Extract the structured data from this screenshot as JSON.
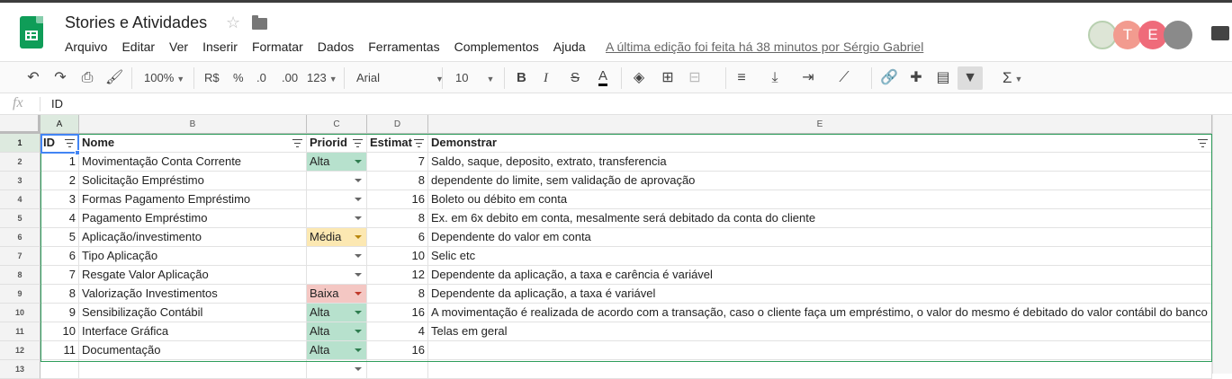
{
  "app": {
    "title": "Stories e Atividades",
    "last_edit": "A última edição foi feita há 38 minutos por Sérgio Gabriel",
    "menu": [
      "Arquivo",
      "Editar",
      "Ver",
      "Inserir",
      "Formatar",
      "Dados",
      "Ferramentas",
      "Complementos",
      "Ajuda"
    ],
    "avatars": [
      "",
      "T",
      "E",
      ""
    ],
    "accent_color": "#0f9d58"
  },
  "toolbar": {
    "zoom": "100%",
    "currency": "R$",
    "percent": "%",
    "dec_decrease": ".0",
    "dec_increase": ".00",
    "format_more": "123",
    "font": "Arial",
    "font_size": "10",
    "bold": "B",
    "italic": "I",
    "strike": "S",
    "text_color": "A",
    "sigma": "Σ"
  },
  "formula_bar": {
    "fx": "fx",
    "value": "ID"
  },
  "sheet": {
    "column_letters": [
      "A",
      "B",
      "C",
      "D",
      "E"
    ],
    "headers": [
      "ID",
      "Nome",
      "Priorid",
      "Estimat",
      "Demonstrar"
    ],
    "row_numbers": [
      "1",
      "2",
      "3",
      "4",
      "5",
      "6",
      "7",
      "8",
      "9",
      "10",
      "11",
      "12",
      "13"
    ],
    "rows": [
      {
        "id": "1",
        "nome": "Movimentação Conta Corrente",
        "prioridade": "Alta",
        "estimativa": "7",
        "demonstrar": "Saldo, saque, deposito, extrato, transferencia"
      },
      {
        "id": "2",
        "nome": "Solicitação Empréstimo",
        "prioridade": "",
        "estimativa": "8",
        "demonstrar": "dependente do limite, sem validação de aprovação"
      },
      {
        "id": "3",
        "nome": "Formas Pagamento Empréstimo",
        "prioridade": "",
        "estimativa": "16",
        "demonstrar": "Boleto ou débito em conta"
      },
      {
        "id": "4",
        "nome": "Pagamento Empréstimo",
        "prioridade": "",
        "estimativa": "8",
        "demonstrar": "Ex. em 6x debito em conta, mesalmente será debitado da conta do cliente"
      },
      {
        "id": "5",
        "nome": "Aplicação/investimento",
        "prioridade": "Média",
        "estimativa": "6",
        "demonstrar": "Dependente do valor em conta"
      },
      {
        "id": "6",
        "nome": "Tipo Aplicação",
        "prioridade": "",
        "estimativa": "10",
        "demonstrar": "Selic etc"
      },
      {
        "id": "7",
        "nome": "Resgate Valor Aplicação",
        "prioridade": "",
        "estimativa": "12",
        "demonstrar": "Dependente da aplicação, a taxa e carência é variável"
      },
      {
        "id": "8",
        "nome": "Valorização Investimentos",
        "prioridade": "Baixa",
        "estimativa": "8",
        "demonstrar": "Dependente da aplicação, a taxa é variável"
      },
      {
        "id": "9",
        "nome": "Sensibilização Contábil",
        "prioridade": "Alta",
        "estimativa": "16",
        "demonstrar": "A movimentação é realizada de acordo com a transação, caso o cliente faça um empréstimo, o valor do mesmo é debitado do valor contábil do banco"
      },
      {
        "id": "10",
        "nome": "Interface Gráfica",
        "prioridade": "Alta",
        "estimativa": "4",
        "demonstrar": "Telas em geral"
      },
      {
        "id": "11",
        "nome": "Documentação",
        "prioridade": "Alta",
        "estimativa": "16",
        "demonstrar": ""
      },
      {
        "id": "",
        "nome": "",
        "prioridade": "",
        "estimativa": "",
        "demonstrar": ""
      }
    ],
    "priority_colors": {
      "Alta": "#b7e1cd",
      "Média": "#fce8b2",
      "Baixa": "#f4c7c3"
    }
  }
}
